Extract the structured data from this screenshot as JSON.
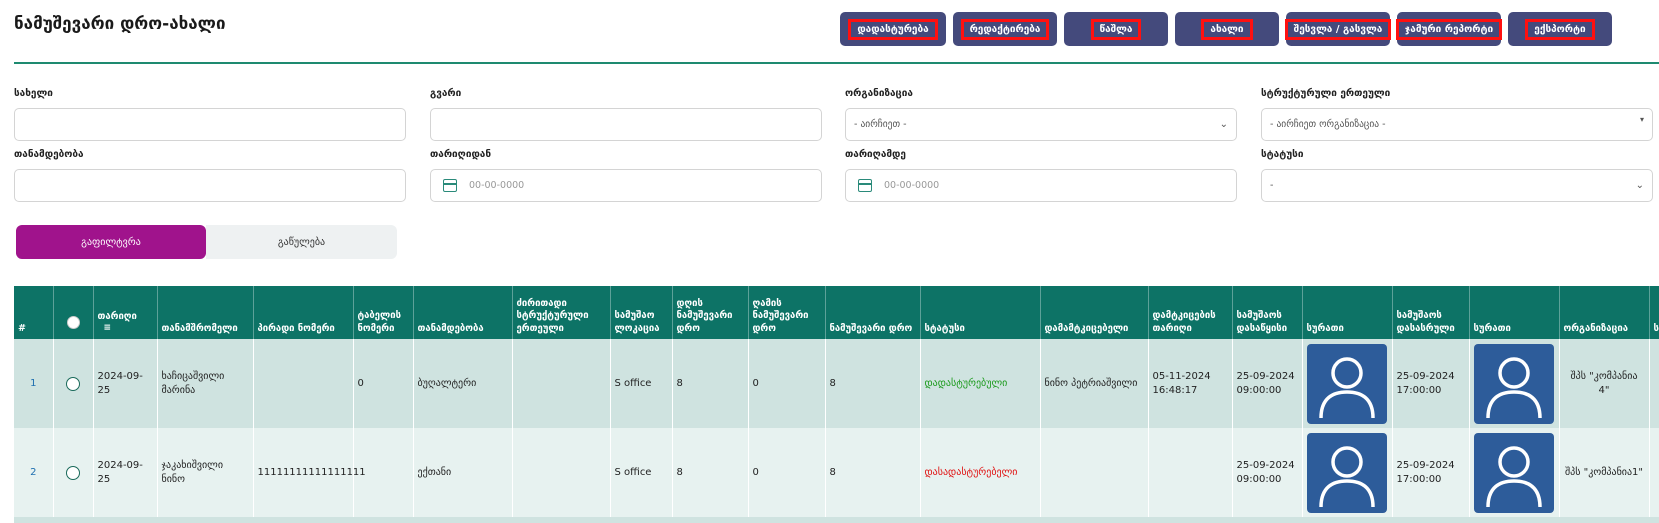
{
  "title": "ნამუშევარი დრო-ახალი",
  "toolbar": [
    {
      "label": "დადასტურება"
    },
    {
      "label": "რედაქტირება"
    },
    {
      "label": "წაშლა"
    },
    {
      "label": "ახალი"
    },
    {
      "label": "შესვლა / გასვლა"
    },
    {
      "label": "ჯამური რეპორტი"
    },
    {
      "label": "ექსპორტი"
    }
  ],
  "filters": {
    "name": {
      "label": "სახელი",
      "value": ""
    },
    "surname": {
      "label": "გვარი",
      "value": ""
    },
    "organization": {
      "label": "ორგანიზაცია",
      "value": "- აირჩიეთ -"
    },
    "unit": {
      "label": "სტრუქტურული ერთეული",
      "value": "- აირჩიეთ ორგანიზაცია -"
    },
    "position": {
      "label": "თანამდებობა",
      "value": ""
    },
    "date_from": {
      "label": "თარიღიდან",
      "placeholder": "00-00-0000"
    },
    "date_to": {
      "label": "თარიღამდე",
      "placeholder": "00-00-0000"
    },
    "status": {
      "label": "სტატუსი",
      "value": "-"
    }
  },
  "actions": {
    "filter": "გაფილტვრა",
    "clear": "გაწულება"
  },
  "table": {
    "headers": [
      "#",
      "",
      "თარიღი",
      "თანამშრომელი",
      "პირადი ნომერი",
      "ტაბელის ნომერი",
      "თანამდებობა",
      "ძირითადი სტრუქტურული ერთეული",
      "სამუშაო ლოკაცია",
      "დღის ნამუშევარი დრო",
      "ღამის ნამუშევარი დრო",
      "ნამუშევარი დრო",
      "სტატუსი",
      "დამამტკიცებელი",
      "დამტკიცების თარიღი",
      "სამუშაოს დასაწყისი",
      "სურათი",
      "სამუშაოს დასასრული",
      "სურათი",
      "ორგანიზაცია",
      "ს"
    ],
    "rows": [
      {
        "idx": "1",
        "date": "2024-09-25",
        "employee": "ხაჩიცაშვილი მარინა",
        "personal_no": "",
        "tabel_no": "0",
        "position": "ბუღალტერი",
        "unit": "",
        "location": "S office",
        "day_time": "8",
        "night_time": "0",
        "work_time": "8",
        "status": "დადასტურებული",
        "status_color": "#1a9a1a",
        "approver": "ნინო პეტრიაშვილი",
        "approve_date": "05-11-2024 16:48:17",
        "start": "25-09-2024 09:00:00",
        "end": "25-09-2024 17:00:00",
        "organization": "შპს \"კომპანია 4\""
      },
      {
        "idx": "2",
        "date": "2024-09-25",
        "employee": "ჯაკახიშვილი ნინო",
        "personal_no": "11111111111111111",
        "tabel_no": "",
        "position": "ექთანი",
        "unit": "",
        "location": "S office",
        "day_time": "8",
        "night_time": "0",
        "work_time": "8",
        "status": "დასადასტურებელი",
        "status_color": "#e01010",
        "approver": "",
        "approve_date": "",
        "start": "25-09-2024 09:00:00",
        "end": "25-09-2024 17:00:00",
        "organization": "შპს \"კომპანია1\""
      }
    ]
  }
}
